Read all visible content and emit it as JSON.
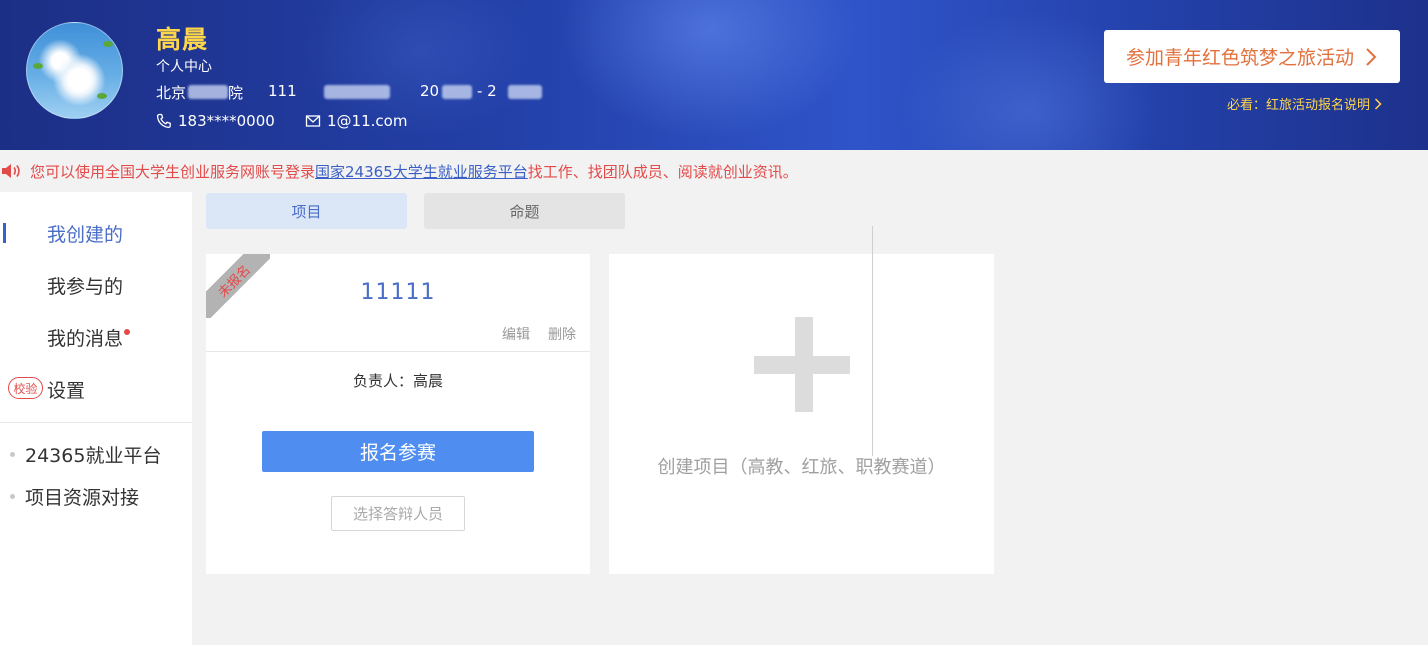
{
  "header": {
    "user_name": "高晨",
    "personal_center": "个人中心",
    "school_prefix": "北京",
    "school_suffix": "院",
    "student_code": "111",
    "year_start": "20",
    "year_dash": "- 2",
    "phone": "183****0000",
    "email": "1@11.com",
    "join_button": "参加青年红色筑梦之旅活动",
    "must_read": "必看：红旅活动报名说明"
  },
  "notice": {
    "prefix": "您可以使用全国大学生创业服务网账号登录",
    "link": "国家24365大学生就业服务平台",
    "suffix": "找工作、找团队成员、阅读就创业资讯。"
  },
  "sidebar": {
    "items": [
      {
        "label": "我创建的"
      },
      {
        "label": "我参与的"
      },
      {
        "label": "我的消息"
      },
      {
        "label": "设置",
        "badge": "校验"
      }
    ],
    "links": [
      {
        "label": "24365就业平台"
      },
      {
        "label": "项目资源对接"
      }
    ]
  },
  "tabs": [
    {
      "label": "项目"
    },
    {
      "label": "命题"
    }
  ],
  "project_card": {
    "ribbon": "未报名",
    "title": "11111",
    "edit": "编辑",
    "delete": "删除",
    "owner": "负责人：高晨",
    "signup_button": "报名参赛",
    "select_button": "选择答辩人员"
  },
  "create_card": {
    "text": "创建项目（高教、红旅、职教赛道）"
  },
  "colors": {
    "header_blue": "#2340a8",
    "name_yellow": "#ffd54a",
    "accent_blue": "#4a6dc8",
    "button_blue": "#4f8ef0",
    "alert_red": "#e34a4a",
    "orange": "#e2713d"
  },
  "icons": {
    "phone": "phone-icon",
    "email": "mail-icon",
    "speaker": "speaker-icon",
    "chevron": "chevron-right-icon",
    "plus": "plus-icon"
  }
}
